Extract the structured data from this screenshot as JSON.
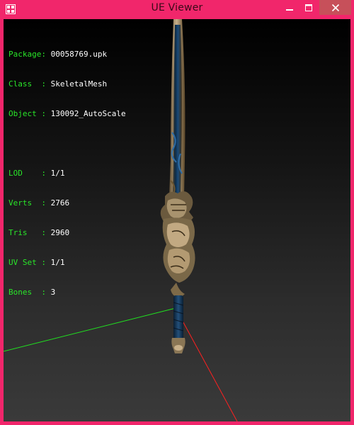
{
  "window": {
    "title": "UE Viewer",
    "accent_color": "#f1266b",
    "icon": "app-grid-icon",
    "buttons": {
      "minimize_icon": "minimize-icon",
      "maximize_icon": "maximize-icon",
      "close_icon": "close-icon"
    }
  },
  "viewport": {
    "background_top": "#000000",
    "background_bottom": "#3a3a3a",
    "axis_colors": {
      "x": "#ff2020",
      "y": "#20e020"
    },
    "info": {
      "label_color": "#29e629",
      "value_color": "#ffffff",
      "group1": [
        {
          "label": "Package:",
          "value": "00058769.upk"
        },
        {
          "label": "Class  :",
          "value": "SkeletalMesh"
        },
        {
          "label": "Object :",
          "value": "130092_AutoScale"
        }
      ],
      "group2": [
        {
          "label": "LOD    :",
          "value": "1/1"
        },
        {
          "label": "Verts  :",
          "value": "2766"
        },
        {
          "label": "Tris   :",
          "value": "2960"
        },
        {
          "label": "UV Set :",
          "value": "1/1"
        },
        {
          "label": "Bones  :",
          "value": "3"
        }
      ]
    }
  }
}
